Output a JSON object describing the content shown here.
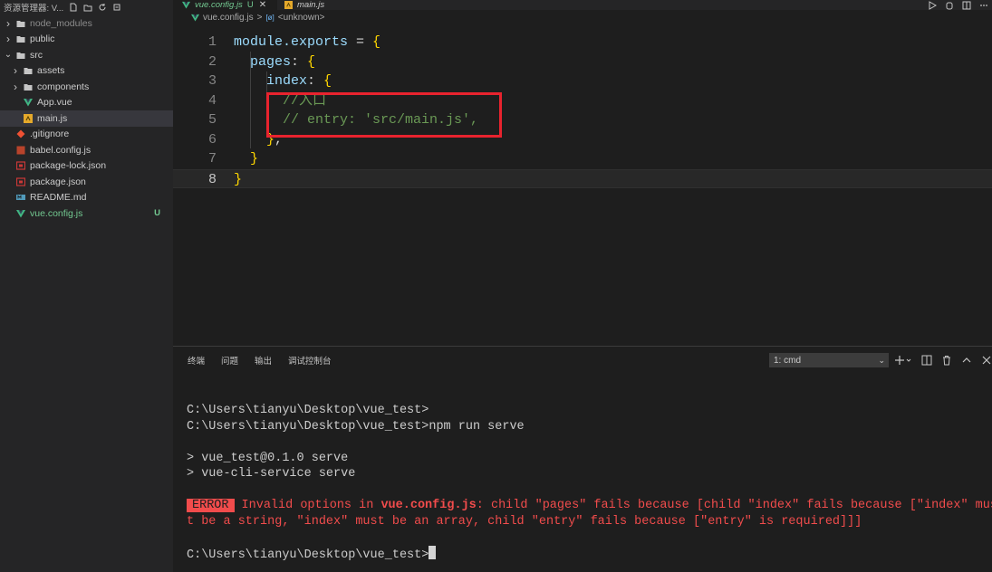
{
  "explorer": {
    "title": "资源管理器: V...",
    "items": [
      {
        "label": "node_modules",
        "kind": "folder",
        "depth": 0,
        "expanded": false,
        "dim": true
      },
      {
        "label": "public",
        "kind": "folder",
        "depth": 0,
        "expanded": false
      },
      {
        "label": "src",
        "kind": "folder",
        "depth": 0,
        "expanded": true
      },
      {
        "label": "assets",
        "kind": "folder",
        "depth": 1,
        "expanded": false
      },
      {
        "label": "components",
        "kind": "folder",
        "depth": 1,
        "expanded": false
      },
      {
        "label": "App.vue",
        "kind": "vue",
        "depth": 1
      },
      {
        "label": "main.js",
        "kind": "js",
        "depth": 1,
        "selected": true
      },
      {
        "label": ".gitignore",
        "kind": "git",
        "depth": 0
      },
      {
        "label": "babel.config.js",
        "kind": "babel",
        "depth": 0
      },
      {
        "label": "package-lock.json",
        "kind": "npm",
        "depth": 0
      },
      {
        "label": "package.json",
        "kind": "npm",
        "depth": 0
      },
      {
        "label": "README.md",
        "kind": "md",
        "depth": 0
      },
      {
        "label": "vue.config.js",
        "kind": "vue",
        "depth": 0,
        "modified": true,
        "badge": "U"
      }
    ]
  },
  "tabs": [
    {
      "label": "vue.config.js",
      "badge": "U",
      "close": "✕",
      "active": true
    },
    {
      "label": "main.js",
      "active": false
    }
  ],
  "breadcrumb": {
    "file": "vue.config.js",
    "separator": ">",
    "symbol_glyph": "[ø]",
    "symbol": "<unknown>"
  },
  "code": {
    "current_line": 8,
    "lines": [
      {
        "n": "1",
        "text": "module.exports = {"
      },
      {
        "n": "2",
        "text": "  pages: {"
      },
      {
        "n": "3",
        "text": "    index: {"
      },
      {
        "n": "4",
        "text": "      //入口"
      },
      {
        "n": "5",
        "text": "      // entry: 'src/main.js',"
      },
      {
        "n": "6",
        "text": "    },"
      },
      {
        "n": "7",
        "text": "  }"
      },
      {
        "n": "8",
        "text": "}"
      }
    ]
  },
  "panel": {
    "tabs": [
      "终端",
      "问题",
      "输出",
      "调试控制台"
    ],
    "terminal_select": "1: cmd",
    "select_chevron": "⌄"
  },
  "terminal": {
    "line1": "C:\\Users\\tianyu\\Desktop\\vue_test>",
    "line2": "C:\\Users\\tianyu\\Desktop\\vue_test>npm run serve",
    "line3": "> vue_test@0.1.0 serve",
    "line4": "> vue-cli-service serve",
    "error_badge": "ERROR",
    "err_pre": "Invalid options in ",
    "err_file": "vue.config.js",
    "err_rest1": ": child \"pages\" fails because [child \"index\" fails because [\"index\" mus",
    "err_line2": "t be a string, \"index\" must be an array, child \"entry\" fails because [\"entry\" is required]]]",
    "prompt": "C:\\Users\\tianyu\\Desktop\\vue_test>"
  },
  "colors": {
    "accent_red": "#e8232e",
    "error": "#f14c4c",
    "modified_green": "#73c991"
  }
}
